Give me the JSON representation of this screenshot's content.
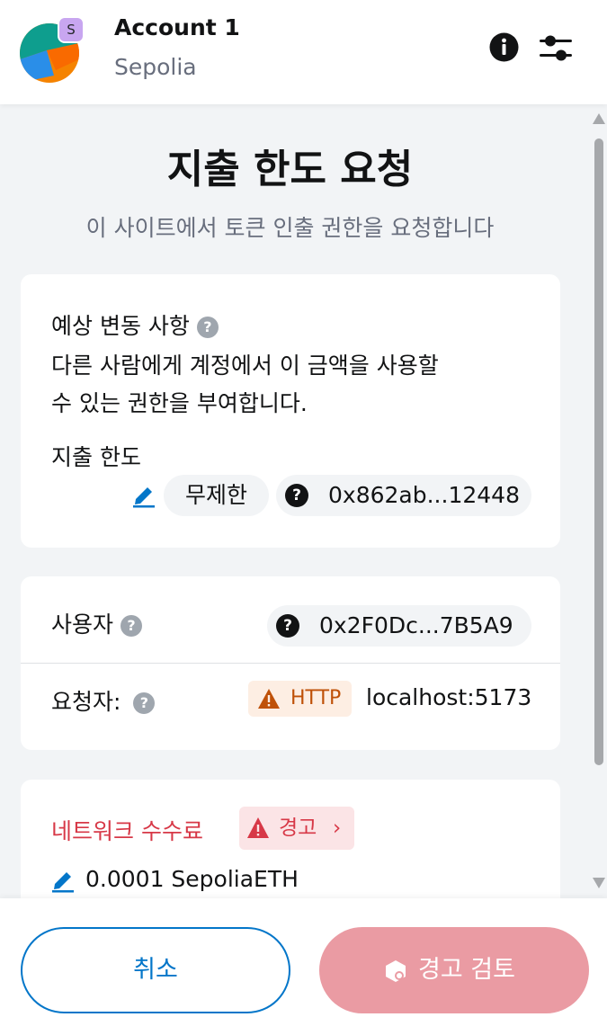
{
  "header": {
    "account_name": "Account 1",
    "network_name": "Sepolia",
    "network_badge": "S",
    "info_icon": "info-icon",
    "settings_icon": "sliders-icon"
  },
  "page": {
    "title": "지출 한도 요청",
    "subtitle": "이 사이트에서 토큰 인출 권한을 요청합니다"
  },
  "estimated_changes": {
    "heading": "예상 변동 사항",
    "description_line1": "다른 사람에게 계정에서 이 금액을 사용할",
    "description_line2": "수 있는 권한을 부여합니다.",
    "limit_label": "지출 한도",
    "limit_value": "무제한",
    "token_address": "0x862ab...12448"
  },
  "details": {
    "spender_label": "사용자",
    "spender_address": "0x2F0Dc...7B5A9",
    "requester_label": "요청자:",
    "requester_protocol": "HTTP",
    "requester_origin": "localhost:5173"
  },
  "fees": {
    "label": "네트워크 수수료",
    "warning_label": "경고",
    "amount": "0.0001 SepoliaETH"
  },
  "footer": {
    "cancel_label": "취소",
    "review_label": "경고 검토"
  },
  "colors": {
    "primary": "#0376c9",
    "danger": "#d73847",
    "warning": "#bf5108",
    "review_button": "#ea9ba3",
    "muted_text": "#686e7d"
  }
}
